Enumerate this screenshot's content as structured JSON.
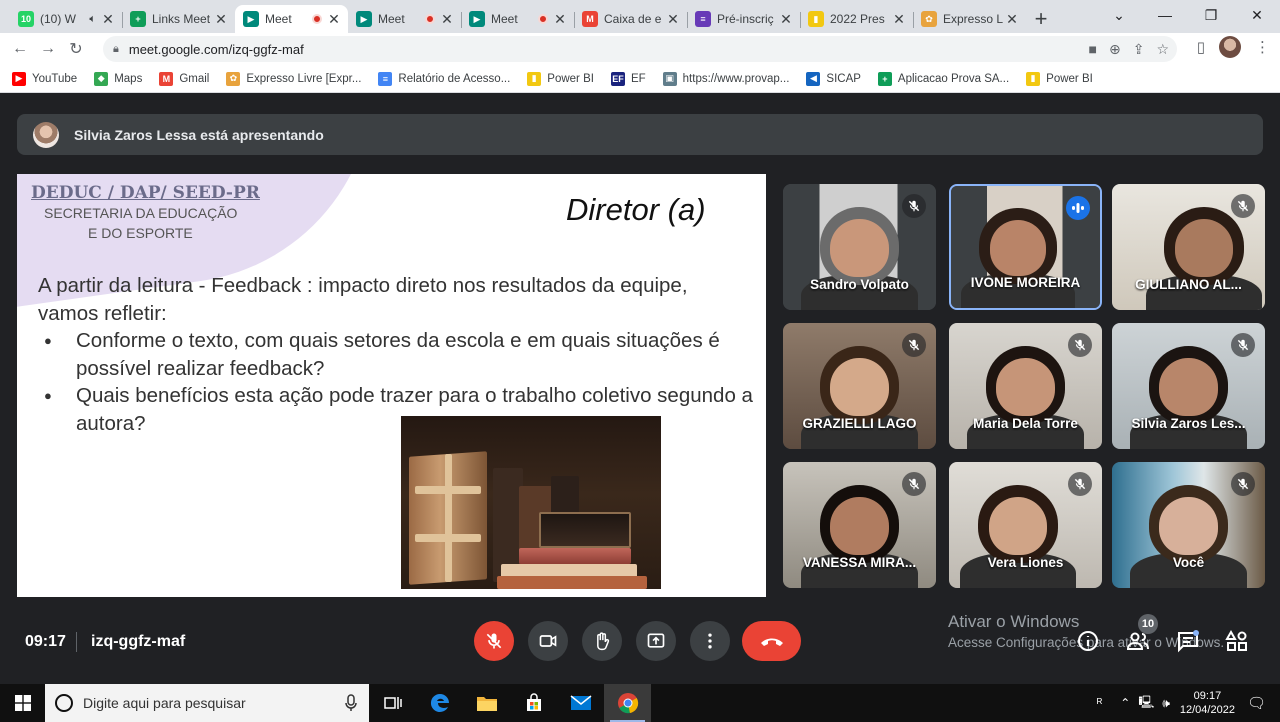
{
  "browser": {
    "tabs": [
      {
        "title": "(10) W",
        "icon": "whatsapp-icon",
        "color": "#25d366",
        "glyph": "10",
        "audio": true
      },
      {
        "title": "Links Meet",
        "icon": "sheets-icon",
        "color": "#0f9d58",
        "glyph": "+"
      },
      {
        "title": "Meet",
        "icon": "meet-icon",
        "color": "#00897b",
        "glyph": "▶",
        "recording": true,
        "active": true
      },
      {
        "title": "Meet",
        "icon": "meet-icon",
        "color": "#00897b",
        "glyph": "▶",
        "recording": true
      },
      {
        "title": "Meet",
        "icon": "meet-icon",
        "color": "#00897b",
        "glyph": "▶",
        "recording": true
      },
      {
        "title": "Caixa de e",
        "icon": "gmail-icon",
        "color": "#ea4335",
        "glyph": "M"
      },
      {
        "title": "Pré-inscriç",
        "icon": "forms-icon",
        "color": "#673ab7",
        "glyph": "≡"
      },
      {
        "title": "2022 Pres",
        "icon": "powerbi-icon",
        "color": "#f2c811",
        "glyph": "▮"
      },
      {
        "title": "Expresso L",
        "icon": "expresso-icon",
        "color": "#e8a33d",
        "glyph": "✿"
      }
    ],
    "url": "meet.google.com/izq-ggfz-maf",
    "bookmarks": [
      {
        "label": "YouTube",
        "icon": "youtube-icon",
        "color": "#ff0000",
        "glyph": "▶"
      },
      {
        "label": "Maps",
        "icon": "maps-icon",
        "color": "#34a853",
        "glyph": "◆"
      },
      {
        "label": "Gmail",
        "icon": "gmail-icon",
        "color": "#ea4335",
        "glyph": "M"
      },
      {
        "label": "Expresso Livre [Expr...",
        "icon": "expresso-icon",
        "color": "#e8a33d",
        "glyph": "✿"
      },
      {
        "label": "Relatório de Acesso...",
        "icon": "report-icon",
        "color": "#4285f4",
        "glyph": "≡"
      },
      {
        "label": "Power BI",
        "icon": "powerbi-icon",
        "color": "#f2c811",
        "glyph": "▮"
      },
      {
        "label": "EF",
        "icon": "ef-icon",
        "color": "#1a237e",
        "glyph": "EF"
      },
      {
        "label": "https://www.provap...",
        "icon": "provap-icon",
        "color": "#607d8b",
        "glyph": "▣"
      },
      {
        "label": "SICAP",
        "icon": "sicap-icon",
        "color": "#1565c0",
        "glyph": "◀"
      },
      {
        "label": "Aplicacao Prova SA...",
        "icon": "sheets-icon",
        "color": "#0f9d58",
        "glyph": "+"
      },
      {
        "label": "Power BI",
        "icon": "powerbi-icon",
        "color": "#f2c811",
        "glyph": "▮"
      }
    ]
  },
  "meet": {
    "presenter_text": "Silvia Zaros Lessa está apresentando",
    "slide": {
      "org": "DEDUC / DAP/ SEED-PR",
      "secretaria_line1": "SECRETARIA DA EDUCAÇÃO",
      "secretaria_line2": "E DO ESPORTE",
      "heading": "Diretor (a)",
      "intro": "A partir da leitura  - Feedback : impacto direto nos resultados da equipe,  vamos refletir:",
      "bullets": [
        "Conforme o texto, com quais setores da escola e em quais situações é possível realizar feedback?",
        "Quais benefícios  esta ação pode trazer para o trabalho coletivo segundo a autora?"
      ]
    },
    "participants": [
      {
        "name": "Sandro Volpato",
        "muted": true
      },
      {
        "name": "IVONE MOREIRA",
        "speaking": true
      },
      {
        "name": "GIULLIANO AL...",
        "muted": true
      },
      {
        "name": "GRAZIELLI LAGO",
        "muted": true
      },
      {
        "name": "Maria Dela Torre",
        "muted": true
      },
      {
        "name": "Silvia Zaros Les...",
        "muted": true
      },
      {
        "name": "VANESSA MIRA...",
        "muted": true
      },
      {
        "name": "Vera Liones",
        "muted": true
      },
      {
        "name": "Você",
        "muted": true
      }
    ],
    "time": "09:17",
    "meeting_code": "izq-ggfz-maf",
    "participant_count": "10",
    "watermark_title": "Ativar o Windows",
    "watermark_sub": "Acesse Configurações para ativar o Windows."
  },
  "taskbar": {
    "search_placeholder": "Digite aqui para pesquisar",
    "clock_time": "09:17",
    "clock_date": "12/04/2022"
  }
}
